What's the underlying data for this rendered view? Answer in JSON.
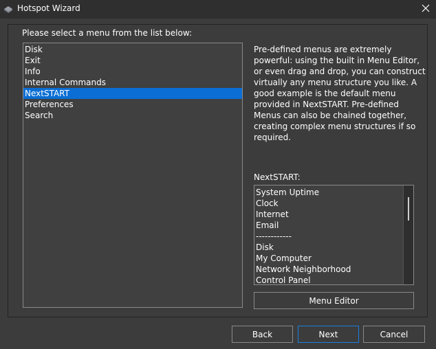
{
  "window": {
    "title": "Hotspot Wizard"
  },
  "instruction": "Please select a menu from the list below:",
  "menus": [
    {
      "label": "Disk",
      "selected": false
    },
    {
      "label": "Exit",
      "selected": false
    },
    {
      "label": "Info",
      "selected": false
    },
    {
      "label": "Internal Commands",
      "selected": false
    },
    {
      "label": "NextSTART",
      "selected": true
    },
    {
      "label": "Preferences",
      "selected": false
    },
    {
      "label": "Search",
      "selected": false
    }
  ],
  "description": "Pre-defined menus are extremely powerful: using the built in Menu Editor, or even drag and drop, you can construct virtually any menu structure you like. A good example is the default menu provided in NextSTART.  Pre-defined Menus can also be chained together, creating complex menu structures if so required.",
  "preview": {
    "label": "NextSTART:",
    "items": [
      "System Uptime",
      "Clock",
      "Internet",
      "Email",
      "------------",
      "Disk",
      "My Computer",
      "Network Neighborhood",
      "Control Panel"
    ]
  },
  "buttons": {
    "menu_editor": "Menu Editor",
    "back": "Back",
    "next": "Next",
    "cancel": "Cancel"
  },
  "colors": {
    "selection": "#0a6ed4",
    "accent_border": "#1a7fe0"
  }
}
